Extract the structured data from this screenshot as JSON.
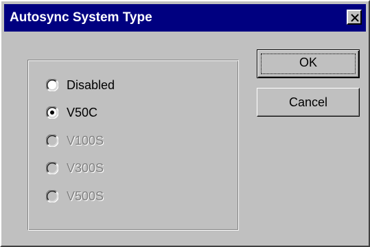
{
  "window": {
    "title": "Autosync System Type",
    "close_symbol": "close-icon"
  },
  "options": [
    {
      "label": "Disabled",
      "selected": false,
      "enabled": true
    },
    {
      "label": "V50C",
      "selected": true,
      "enabled": true
    },
    {
      "label": "V100S",
      "selected": false,
      "enabled": false
    },
    {
      "label": "V300S",
      "selected": false,
      "enabled": false
    },
    {
      "label": "V500S",
      "selected": false,
      "enabled": false
    }
  ],
  "buttons": {
    "ok_label": "OK",
    "cancel_label": "Cancel"
  },
  "colors": {
    "face": "#c0c0c0",
    "titlebar": "#000080",
    "disabled_text": "#808080"
  }
}
